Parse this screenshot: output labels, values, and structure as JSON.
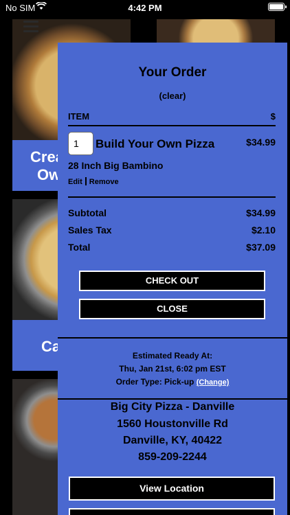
{
  "status_bar": {
    "carrier": "No SIM",
    "time": "4:42 PM"
  },
  "background_menu": {
    "tiles": [
      {
        "title": "Crea",
        "subtitle": "Ow"
      },
      {
        "title": "Ca"
      }
    ]
  },
  "order": {
    "title": "Your Order",
    "clear_label": "(clear)",
    "header_item": "ITEM",
    "header_price": "$",
    "items": [
      {
        "quantity": "1",
        "name": "Build Your Own Pizza",
        "price": "$34.99",
        "option": "28 Inch Big Bambino",
        "edit_label": "Edit",
        "remove_label": "Remove"
      }
    ],
    "subtotal_label": "Subtotal",
    "subtotal_value": "$34.99",
    "tax_label": "Sales Tax",
    "tax_value": "$2.10",
    "total_label": "Total",
    "total_value": "$37.09",
    "checkout_label": "CHECK OUT",
    "close_label": "CLOSE",
    "estimated_label": "Estimated Ready At:",
    "estimated_time": "Thu, Jan 21st, 6:02 pm EST",
    "order_type_label": "Order Type: Pick-up",
    "change_label": "(Change)"
  },
  "store": {
    "name": "Big City Pizza - Danville",
    "address_line1": "1560 Houstonville Rd",
    "address_line2": "Danville, KY, 40422",
    "phone": "859-209-2244",
    "view_location_label": "View Location"
  },
  "colors": {
    "panel_blue": "#4a68d0",
    "button_black": "#000000"
  }
}
